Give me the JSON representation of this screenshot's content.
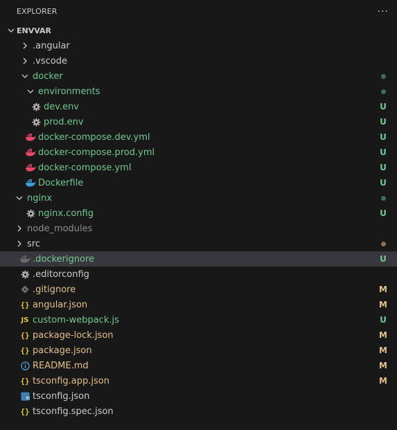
{
  "header": {
    "title": "EXPLORER",
    "more": "···"
  },
  "section": {
    "title": "ENVVAR"
  },
  "colors": {
    "untracked": "#73c991",
    "modified": "#e2c08d",
    "ignored": "#8c8c8c",
    "selected_bg": "#37373d",
    "docker_blue": "#3b9fd8",
    "docker_pink": "#e8476a",
    "json_yellow": "#e2c541",
    "ts_blue": "#3f7fb3",
    "info_blue": "#59a8e0"
  },
  "items": [
    {
      "name": ".angular",
      "type": "folder",
      "expanded": false,
      "indent": 1,
      "color": "norm",
      "badge": "",
      "dot": ""
    },
    {
      "name": ".vscode",
      "type": "folder",
      "expanded": false,
      "indent": 1,
      "color": "norm",
      "badge": "",
      "dot": ""
    },
    {
      "name": "docker",
      "type": "folder",
      "expanded": true,
      "indent": 1,
      "color": "green",
      "badge": "",
      "dot": "green"
    },
    {
      "name": "environments",
      "type": "folder",
      "expanded": true,
      "indent": 2,
      "color": "green",
      "badge": "",
      "dot": "green"
    },
    {
      "name": "dev.env",
      "type": "file",
      "icon": "gear-icon",
      "indent": 2,
      "color": "green",
      "badge": "U",
      "dot": ""
    },
    {
      "name": "prod.env",
      "type": "file",
      "icon": "gear-icon",
      "indent": 2,
      "color": "green",
      "badge": "U",
      "dot": ""
    },
    {
      "name": "docker-compose.dev.yml",
      "type": "file",
      "icon": "docker-pink-icon",
      "indent": 1,
      "color": "green",
      "badge": "U",
      "dot": ""
    },
    {
      "name": "docker-compose.prod.yml",
      "type": "file",
      "icon": "docker-pink-icon",
      "indent": 1,
      "color": "green",
      "badge": "U",
      "dot": ""
    },
    {
      "name": "docker-compose.yml",
      "type": "file",
      "icon": "docker-pink-icon",
      "indent": 1,
      "color": "green",
      "badge": "U",
      "dot": ""
    },
    {
      "name": "Dockerfile",
      "type": "file",
      "icon": "docker-blue-icon",
      "indent": 1,
      "color": "green",
      "badge": "U",
      "dot": ""
    },
    {
      "name": "nginx",
      "type": "folder",
      "expanded": true,
      "indent": 0,
      "color": "green",
      "badge": "",
      "dot": "green"
    },
    {
      "name": "nginx.config",
      "type": "file",
      "icon": "gear-icon",
      "indent": 1,
      "color": "green",
      "badge": "U",
      "dot": ""
    },
    {
      "name": "node_modules",
      "type": "folder",
      "expanded": false,
      "indent": 0,
      "color": "dim",
      "badge": "",
      "dot": ""
    },
    {
      "name": "src",
      "type": "folder",
      "expanded": false,
      "indent": 0,
      "color": "norm",
      "badge": "",
      "dot": "mod"
    },
    {
      "name": ".dockerignore",
      "type": "file",
      "icon": "docker-gray-icon",
      "indent": 0,
      "color": "green",
      "badge": "U",
      "dot": "",
      "selected": true
    },
    {
      "name": ".editorconfig",
      "type": "file",
      "icon": "gear-icon",
      "indent": 0,
      "color": "norm",
      "badge": "",
      "dot": ""
    },
    {
      "name": ".gitignore",
      "type": "file",
      "icon": "git-icon",
      "indent": 0,
      "color": "mod",
      "badge": "M",
      "dot": ""
    },
    {
      "name": "angular.json",
      "type": "file",
      "icon": "json-icon",
      "indent": 0,
      "color": "mod",
      "badge": "M",
      "dot": ""
    },
    {
      "name": "custom-webpack.js",
      "type": "file",
      "icon": "js-icon",
      "indent": 0,
      "color": "green",
      "badge": "U",
      "dot": ""
    },
    {
      "name": "package-lock.json",
      "type": "file",
      "icon": "json-icon",
      "indent": 0,
      "color": "mod",
      "badge": "M",
      "dot": ""
    },
    {
      "name": "package.json",
      "type": "file",
      "icon": "json-icon",
      "indent": 0,
      "color": "mod",
      "badge": "M",
      "dot": ""
    },
    {
      "name": "README.md",
      "type": "file",
      "icon": "info-icon",
      "indent": 0,
      "color": "mod",
      "badge": "M",
      "dot": ""
    },
    {
      "name": "tsconfig.app.json",
      "type": "file",
      "icon": "json-icon",
      "indent": 0,
      "color": "mod",
      "badge": "M",
      "dot": ""
    },
    {
      "name": "tsconfig.json",
      "type": "file",
      "icon": "ts-icon",
      "indent": 0,
      "color": "norm",
      "badge": "",
      "dot": ""
    },
    {
      "name": "tsconfig.spec.json",
      "type": "file",
      "icon": "json-icon",
      "indent": 0,
      "color": "norm",
      "badge": "",
      "dot": ""
    }
  ]
}
